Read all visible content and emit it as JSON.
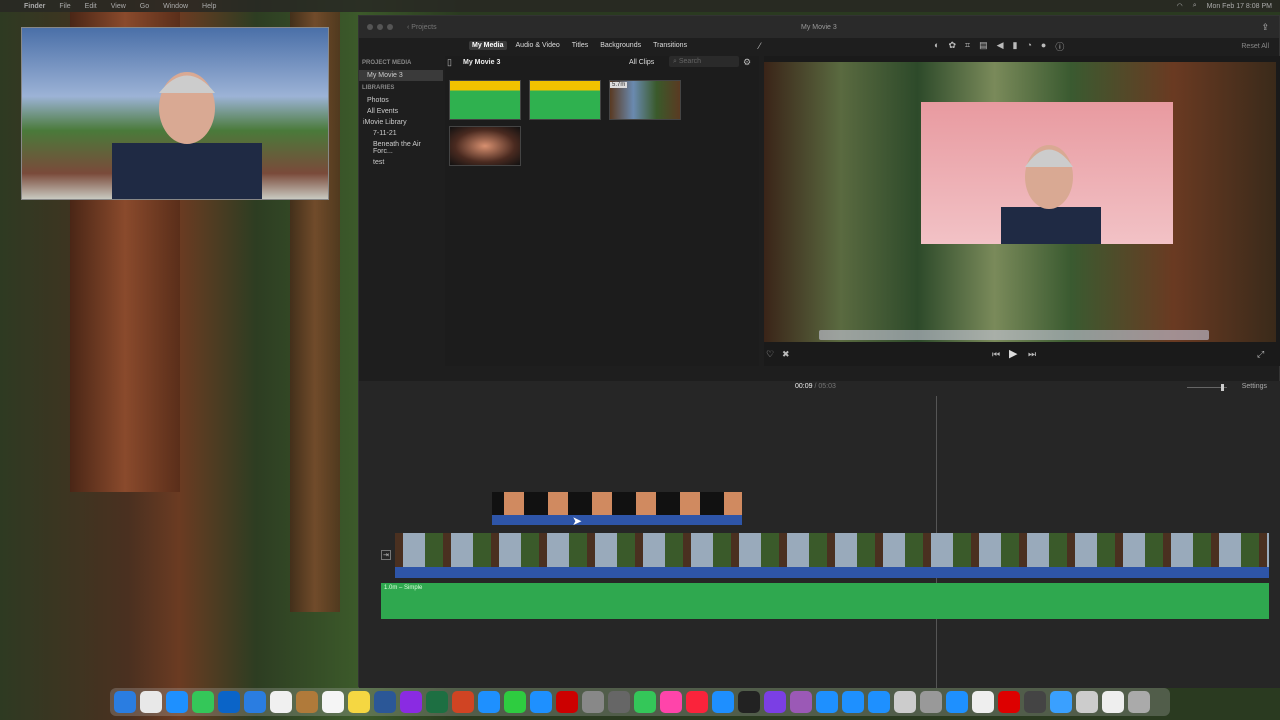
{
  "menubar": {
    "items": [
      "Finder",
      "File",
      "Edit",
      "View",
      "Go",
      "Window",
      "Help"
    ],
    "clock": "Mon Feb 17  8:08 PM"
  },
  "imovie": {
    "window_title": "My Movie 3",
    "back_label": "Projects",
    "tabs": [
      "My Media",
      "Audio & Video",
      "Titles",
      "Backgrounds",
      "Transitions"
    ],
    "sidebar": {
      "project_media_header": "PROJECT MEDIA",
      "project": "My Movie 3",
      "libraries_header": "LIBRARIES",
      "items": [
        "Photos",
        "All Events",
        "iMovie Library",
        "7-11-21",
        "Beneath the Air Forc...",
        "test"
      ]
    },
    "browser": {
      "title": "My Movie 3",
      "filter": "All Clips",
      "search_placeholder": "Search",
      "clip_duration": "5.7m"
    },
    "reset_all": "Reset All",
    "timecode": {
      "current": "00:09",
      "total": "05:03"
    },
    "settings": "Settings",
    "audio_clip_label": "1.0m – Simple"
  },
  "dock": {
    "colors": [
      "#2a7de1",
      "#e8e8e8",
      "#1e90ff",
      "#34c759",
      "#0a64c8",
      "#2a7de1",
      "#f0f0f0",
      "#b07a3a",
      "#f5f5f5",
      "#f5d742",
      "#2b5797",
      "#8a2be2",
      "#1d6f42",
      "#d04423",
      "#1e90ff",
      "#2ecc40",
      "#1e90ff",
      "#c00",
      "#888",
      "#666",
      "#34c759",
      "#f4a",
      "#fa233b",
      "#1e8fff",
      "#222",
      "#7b3fe4",
      "#9b59b6",
      "#1e90ff",
      "#1e90ff",
      "#1e90ff",
      "#ccc",
      "#999",
      "#1e90ff",
      "#eee",
      "#d00",
      "#444",
      "#3aa0ff",
      "#ccc",
      "#eee",
      "#aaa"
    ]
  }
}
